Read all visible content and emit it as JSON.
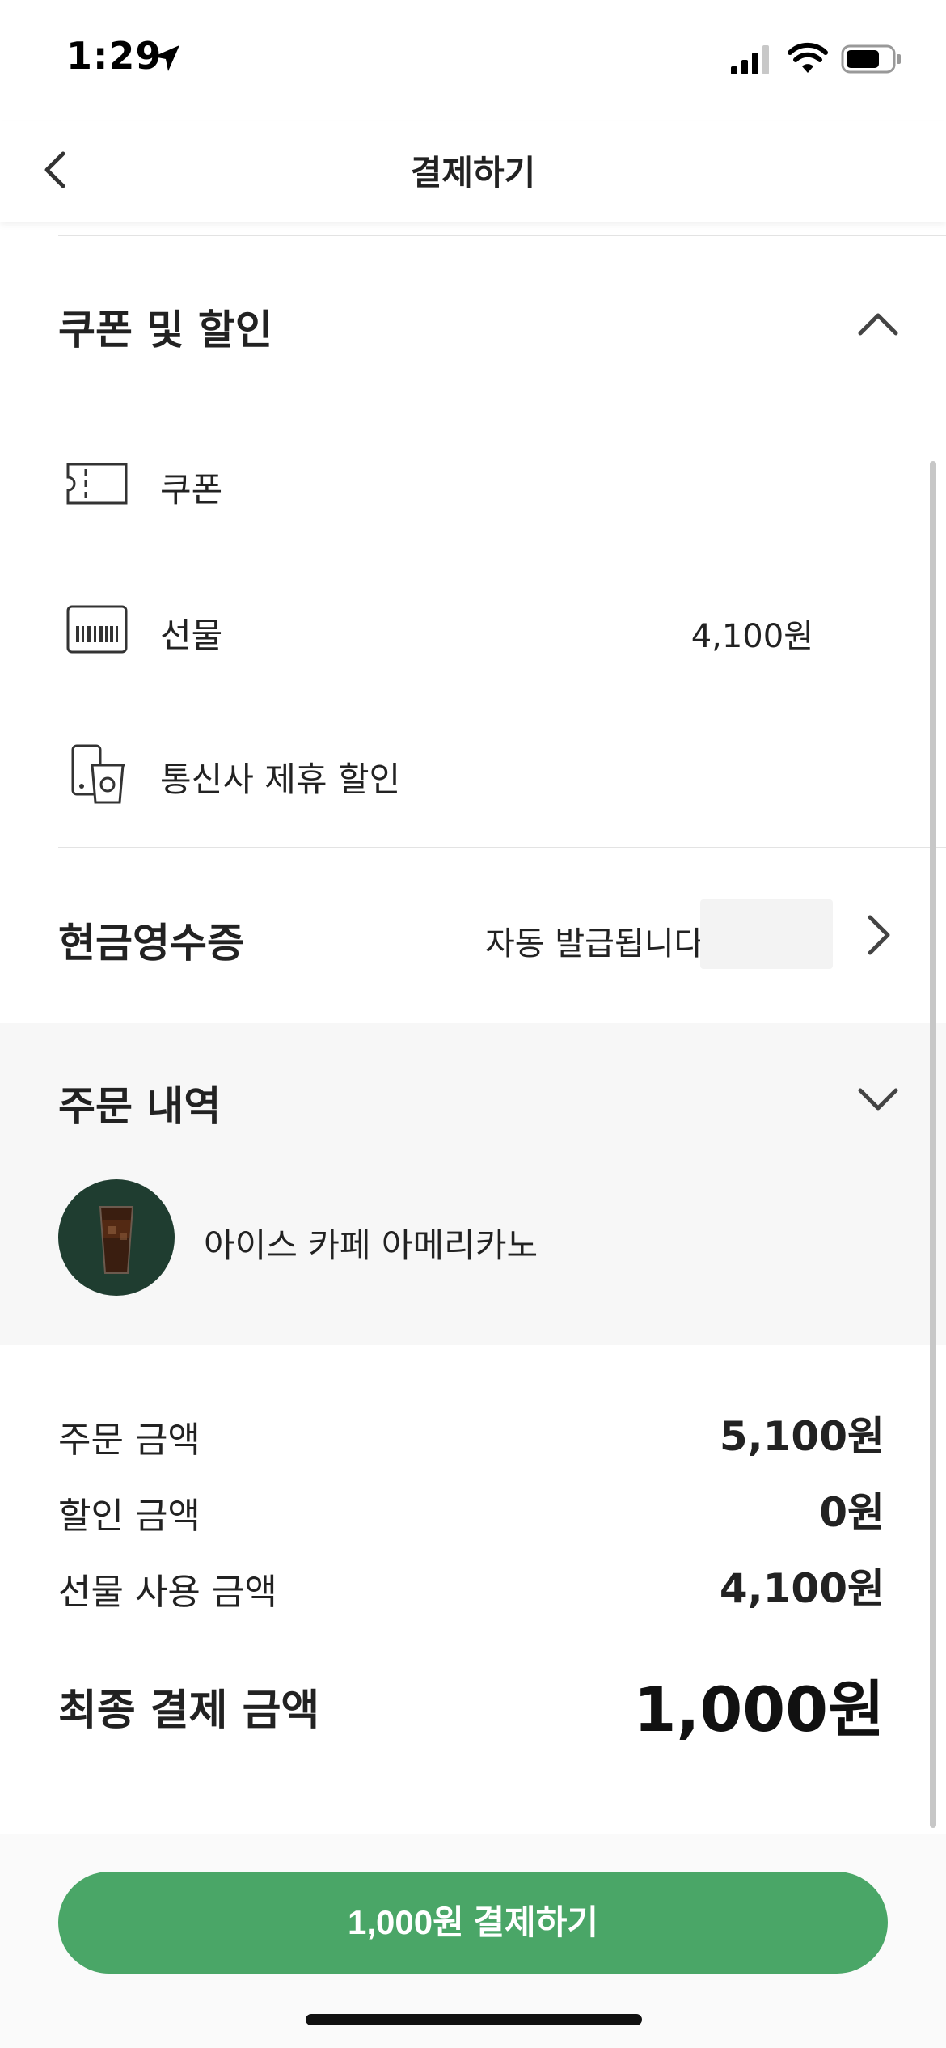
{
  "status_bar": {
    "time": "1:29",
    "icons": [
      "location-arrow-icon",
      "signal-icon",
      "wifi-icon",
      "battery-icon"
    ]
  },
  "nav": {
    "title": "결제하기",
    "back_icon": "chevron-left-icon"
  },
  "coupon_section": {
    "title": "쿠폰 및 할인",
    "expanded": true,
    "items": [
      {
        "label": "쿠폰",
        "value": "",
        "icon": "ticket-icon"
      },
      {
        "label": "선물",
        "value": "4,100원",
        "icon": "barcode-card-icon"
      },
      {
        "label": "통신사 제휴 할인",
        "value": "",
        "icon": "phone-cup-icon"
      }
    ]
  },
  "cash_receipt": {
    "title": "현금영수증",
    "value": "자동 발급됩니다"
  },
  "order_history": {
    "title": "주문 내역",
    "expanded": false,
    "item": "아이스 카페 아메리카노"
  },
  "summary": {
    "rows": [
      {
        "label": "주문 금액",
        "value": "5,100원"
      },
      {
        "label": "할인 금액",
        "value": "0원"
      },
      {
        "label": "선물 사용 금액",
        "value": "4,100원"
      }
    ],
    "final_label": "최종 결제 금액",
    "final_value": "1,000원"
  },
  "pay_button": {
    "label": "1,000원 결제하기"
  },
  "colors": {
    "accent": "#4aa667",
    "panel_bg": "#f7f7f7",
    "thumb_bg": "#1f3d30"
  }
}
